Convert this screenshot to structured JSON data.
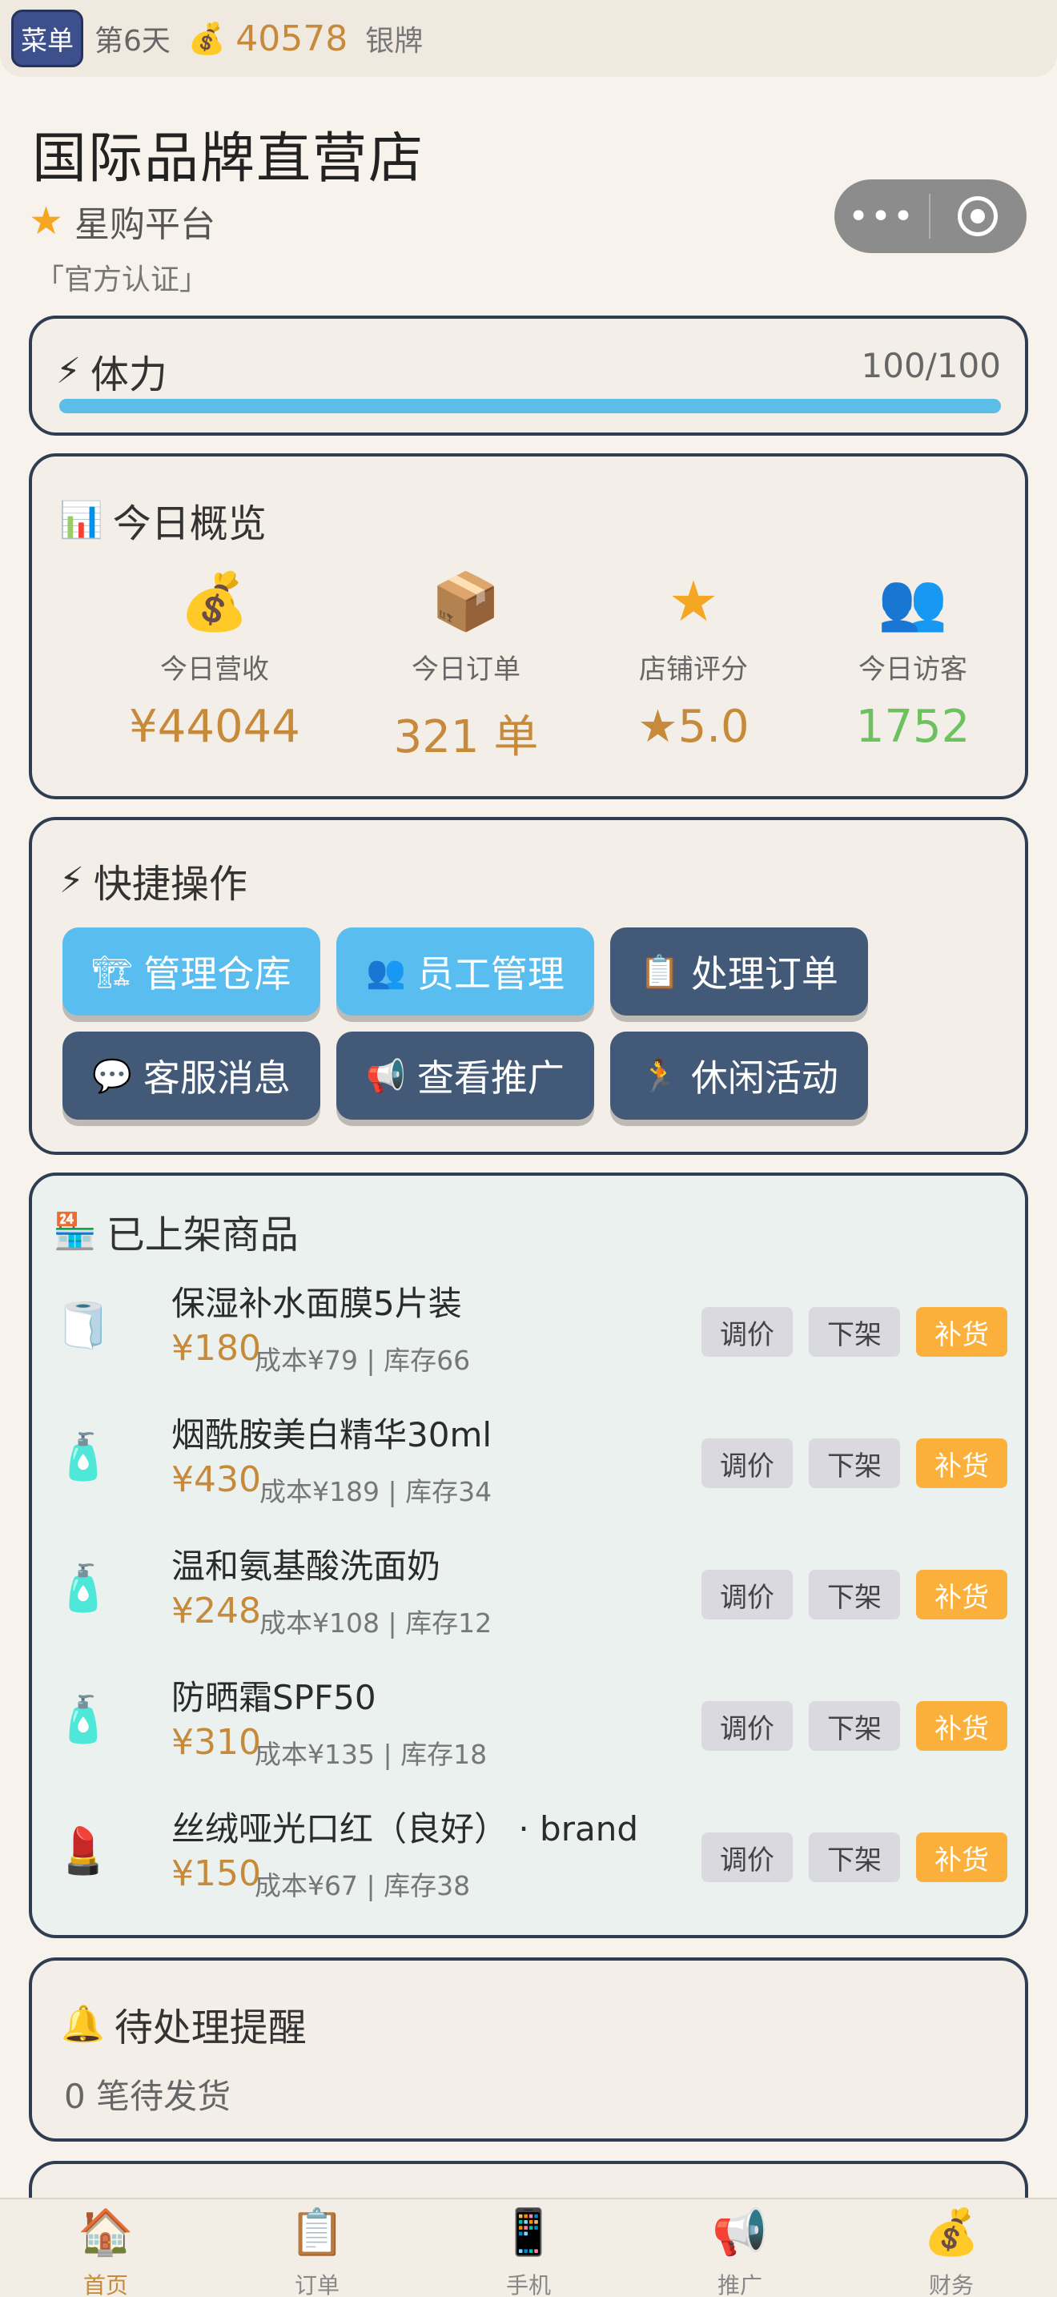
{
  "topbar": {
    "menu_label": "菜单",
    "day": "第6天",
    "coin_icon": "money-bag-icon",
    "coins": "40578",
    "rank": "银牌"
  },
  "shop": {
    "title": "国际品牌直营店",
    "platform": "星购平台",
    "certified": "「官方认证」"
  },
  "stamina": {
    "label": "体力",
    "value": "100/100",
    "percent": 100,
    "bar_color": "#5bbde8"
  },
  "overview": {
    "title": "今日概览",
    "stats": [
      {
        "icon": "money-bag-icon",
        "label": "今日营收",
        "value": "¥44044",
        "color": "#c68a3a"
      },
      {
        "icon": "package-icon",
        "label": "今日订单",
        "value": "321 单",
        "color": "#c68a3a"
      },
      {
        "icon": "star-icon",
        "label": "店铺评分",
        "value": "★5.0",
        "color": "#c68a3a"
      },
      {
        "icon": "users-icon",
        "label": "今日访客",
        "value": "1752",
        "color": "#6cc25e"
      }
    ]
  },
  "quick": {
    "title": "快捷操作",
    "buttons": [
      {
        "icon": "crane-icon",
        "label": "管理仓库",
        "style": "light"
      },
      {
        "icon": "users-icon",
        "label": "员工管理",
        "style": "light"
      },
      {
        "icon": "clipboard-icon",
        "label": "处理订单",
        "style": "dark"
      },
      {
        "icon": "chat-bubble-icon",
        "label": "客服消息",
        "style": "dark"
      },
      {
        "icon": "megaphone-icon",
        "label": "查看推广",
        "style": "dark"
      },
      {
        "icon": "running-icon",
        "label": "休闲活动",
        "style": "dark"
      }
    ]
  },
  "products": {
    "title": "已上架商品",
    "actions": {
      "adjust": "调价",
      "delist": "下架",
      "restock": "补货"
    },
    "items": [
      {
        "icon": "face-mask-icon",
        "name": "保湿补水面膜5片装",
        "price": "¥180",
        "meta": "成本¥79 | 库存66"
      },
      {
        "icon": "serum-bottle-icon",
        "name": "烟酰胺美白精华30ml",
        "price": "¥430",
        "meta": "成本¥189 | 库存34"
      },
      {
        "icon": "cleanser-tube-icon",
        "name": "温和氨基酸洗面奶",
        "price": "¥248",
        "meta": "成本¥108 | 库存12"
      },
      {
        "icon": "sunscreen-icon",
        "name": "防晒霜SPF50",
        "price": "¥310",
        "meta": "成本¥135 | 库存18"
      },
      {
        "icon": "lipstick-icon",
        "name": "丝绒哑光口红（良好） · brand",
        "price": "¥150",
        "meta": "成本¥67 | 库存38"
      }
    ]
  },
  "reminder": {
    "title": "待处理提醒",
    "text": "0 笔待发货"
  },
  "tabbar": [
    {
      "icon": "home-icon",
      "label": "首页",
      "active": true
    },
    {
      "icon": "clipboard-icon",
      "label": "订单",
      "active": false
    },
    {
      "icon": "phone-icon",
      "label": "手机",
      "active": false
    },
    {
      "icon": "megaphone-icon",
      "label": "推广",
      "active": false
    },
    {
      "icon": "money-bag-icon",
      "label": "财务",
      "active": false
    }
  ]
}
